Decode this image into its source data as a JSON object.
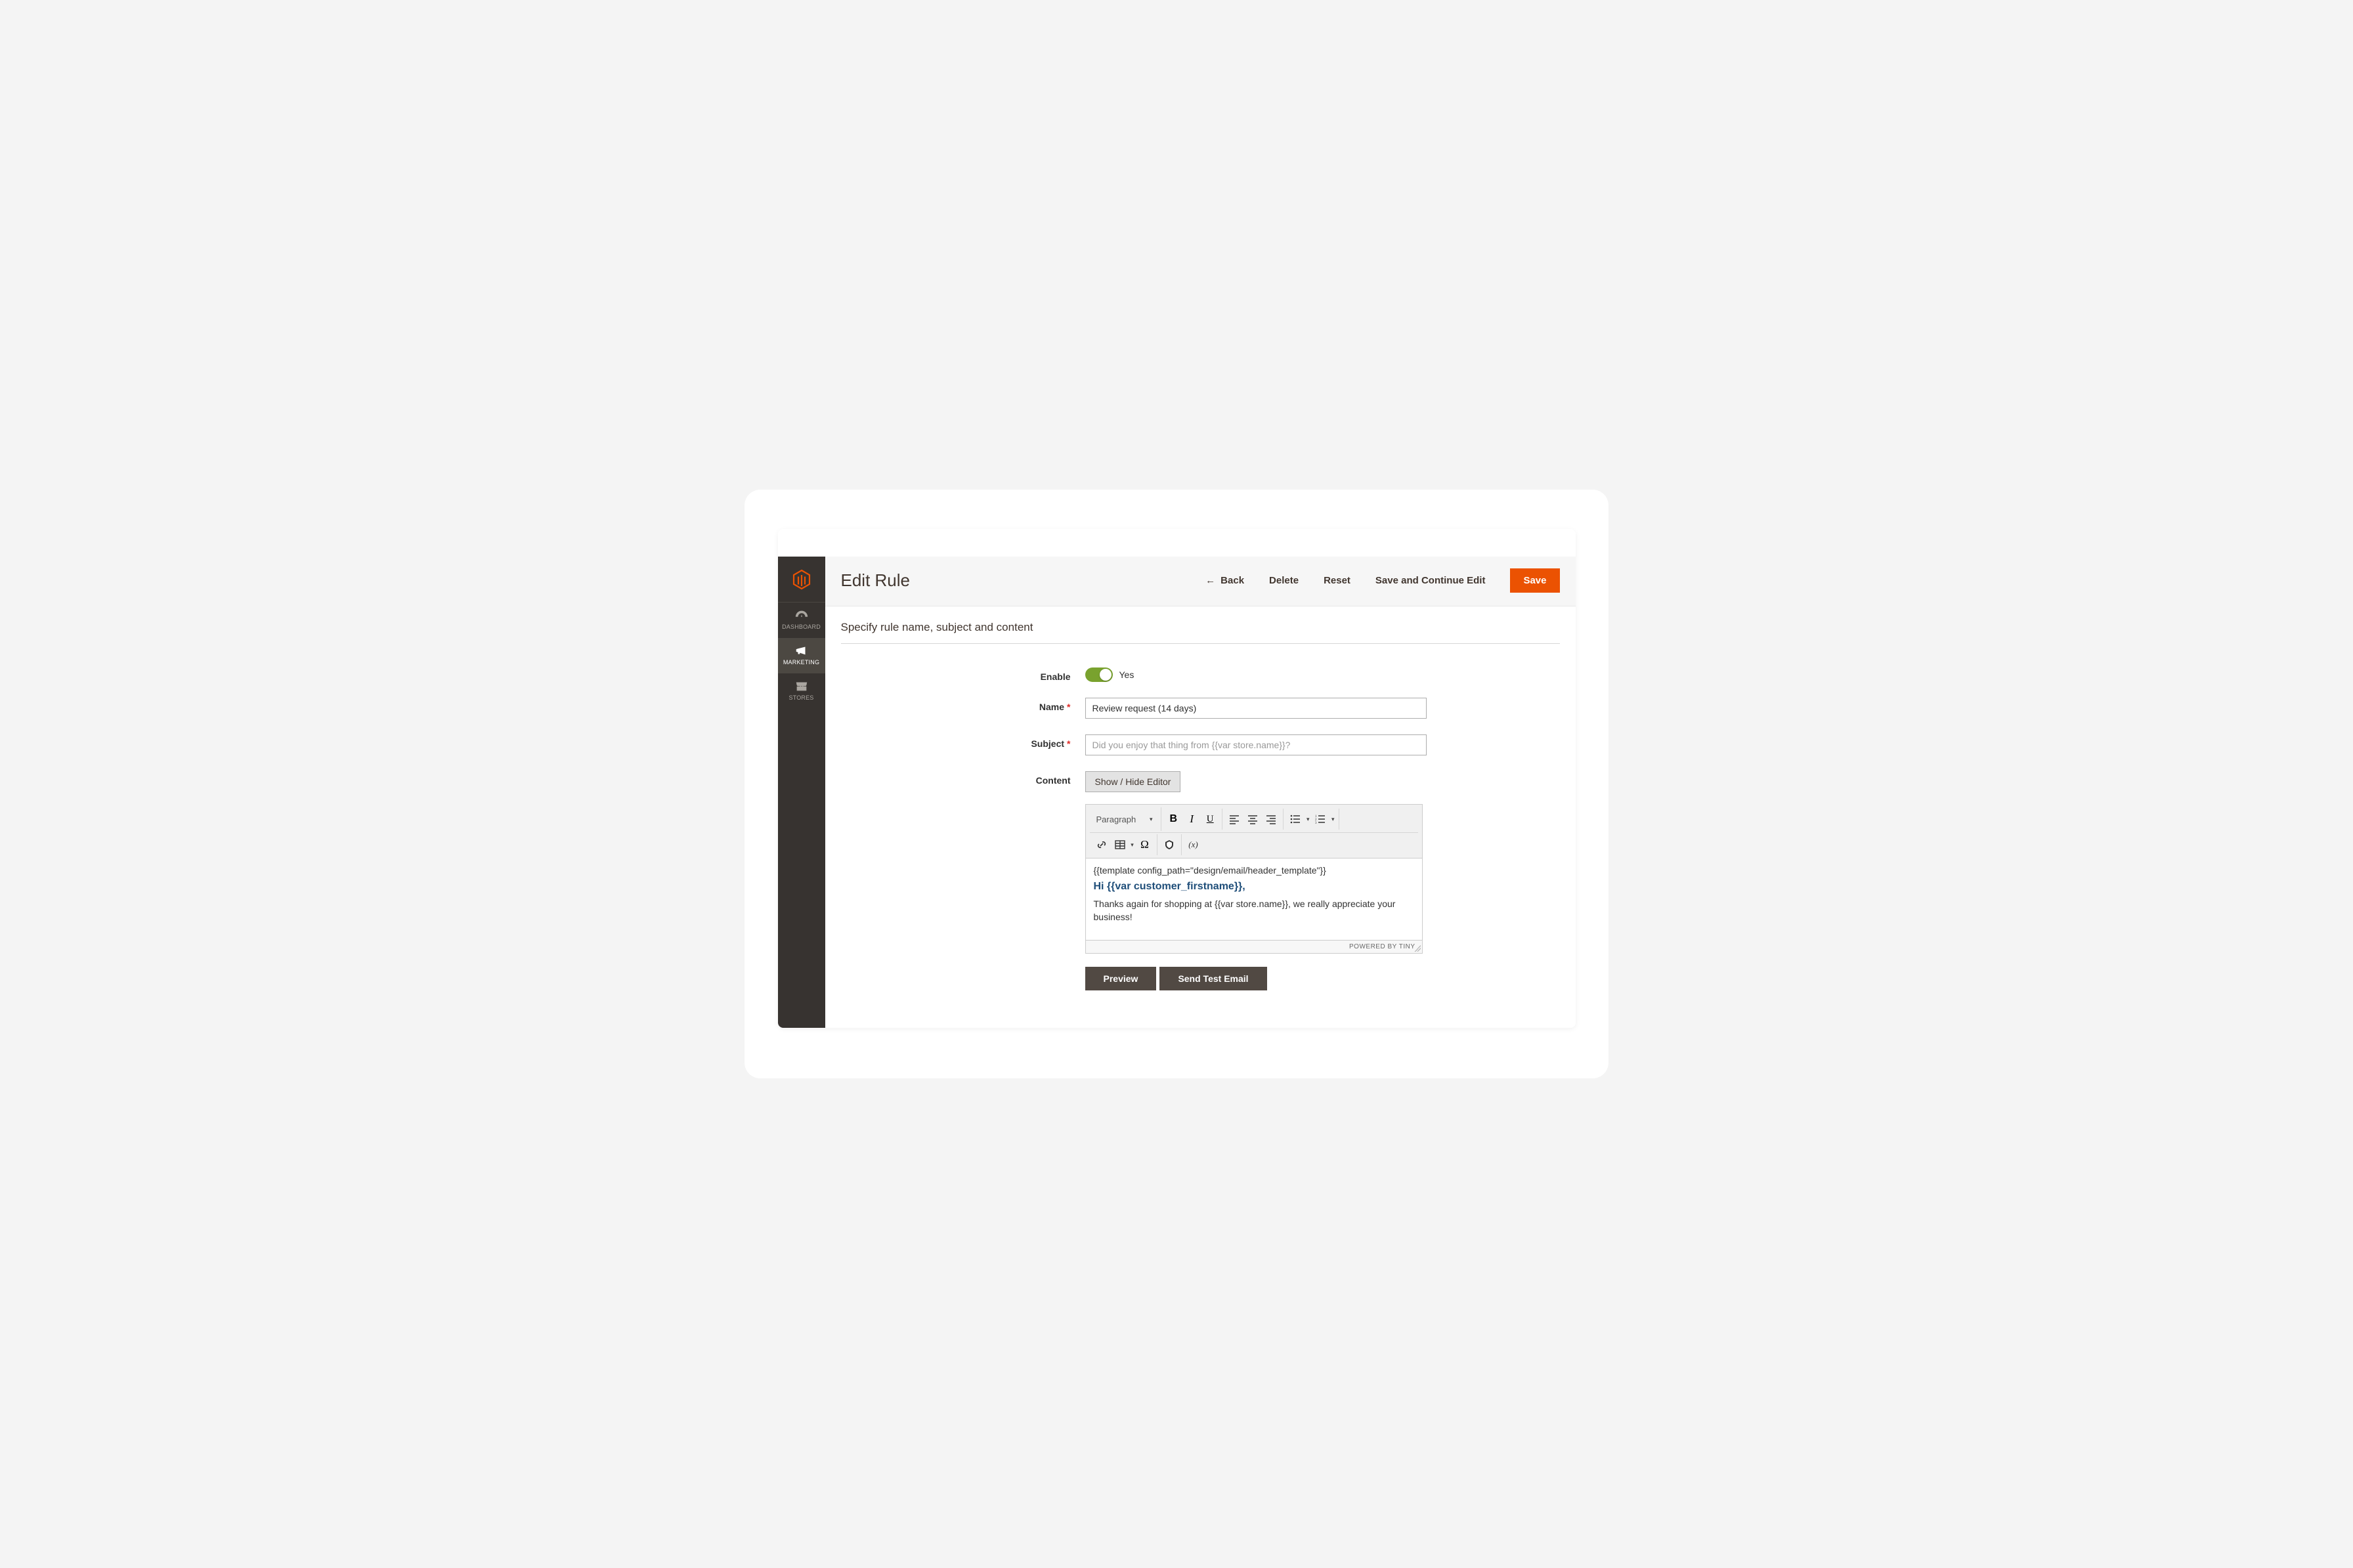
{
  "page": {
    "title": "Edit Rule",
    "section_title": "Specify rule name, subject and content"
  },
  "header_actions": {
    "back": "Back",
    "delete": "Delete",
    "reset": "Reset",
    "save_continue": "Save and Continue Edit",
    "save": "Save"
  },
  "sidebar": {
    "items": [
      {
        "key": "dashboard",
        "label": "DASHBOARD"
      },
      {
        "key": "marketing",
        "label": "MARKETING"
      },
      {
        "key": "stores",
        "label": "STORES"
      }
    ]
  },
  "form": {
    "enable": {
      "label": "Enable",
      "value_label": "Yes",
      "on": true
    },
    "name": {
      "label": "Name",
      "required": true,
      "value": "Review request (14 days)"
    },
    "subject": {
      "label": "Subject",
      "required": true,
      "placeholder": "Did you enjoy that thing from {{var store.name}}?"
    },
    "content": {
      "label": "Content",
      "show_hide_btn": "Show / Hide Editor",
      "preview_btn": "Preview",
      "send_test_btn": "Send Test Email"
    }
  },
  "editor": {
    "format_selector": "Paragraph",
    "body": {
      "template_line": "{{template config_path=\"design/email/header_template\"}}",
      "greeting": "Hi {{var customer_firstname}},",
      "paragraph": "Thanks again for shopping at {{var store.name}}, we really appreciate your business!"
    },
    "footer": "POWERED BY TINY",
    "toolbar_icons": {
      "bold": "B",
      "italic": "I",
      "underline": "U",
      "align_left": "align-left",
      "align_center": "align-center",
      "align_right": "align-right",
      "bullet_list": "bullet-list",
      "numbered_list": "numbered-list",
      "link": "link",
      "table": "table",
      "omega": "Ω",
      "cube": "cube",
      "variable": "(x)"
    }
  },
  "colors": {
    "accent": "#eb5202",
    "sidebar_bg": "#373330",
    "toggle_on": "#79a22e",
    "dark_btn": "#514943"
  }
}
